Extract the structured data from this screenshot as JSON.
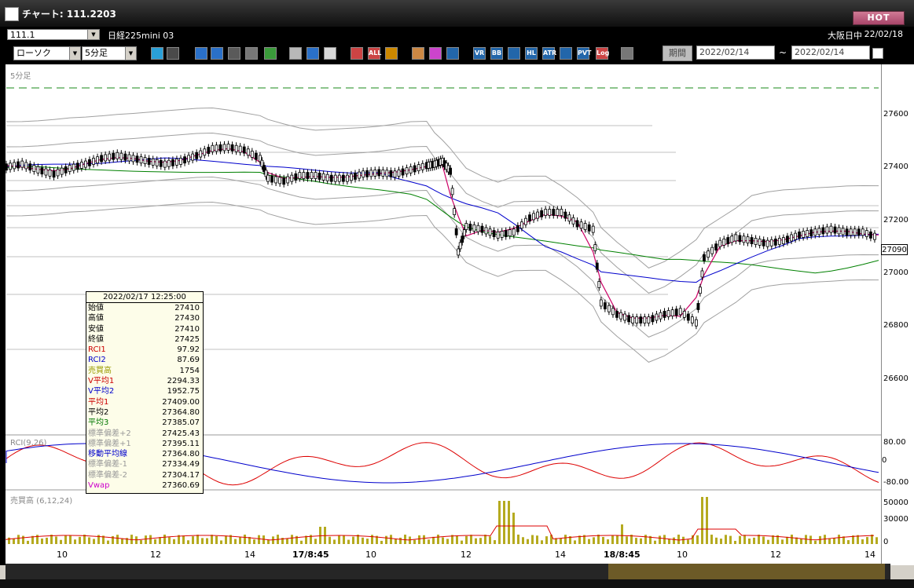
{
  "window": {
    "title": "チャート: 111.2203",
    "hot_label": "HOT"
  },
  "symbol_bar": {
    "code": "111.1",
    "name": "日経225mini 03",
    "market": "大阪日中",
    "date": "22/02/18"
  },
  "toolbar": {
    "chart_type": "ローソク",
    "interval": "5分足",
    "icons": [
      "zoom-icon",
      "cursor-icon",
      "down-icon",
      "search-icon",
      "grid-icon",
      "frame-icon",
      "pen-icon",
      "pointer-icon",
      "return-icon",
      "candle-icon",
      "bar-icon",
      "all-icon",
      "gear-icon",
      "wrench-icon",
      "color-icon",
      "ma-icon",
      "vr-icon",
      "bb-icon",
      "vwap-icon",
      "hl-icon",
      "atr-icon",
      "para-icon",
      "pvt-icon",
      "log-icon",
      "export-icon"
    ],
    "icon_labels": {
      "all": "ALL",
      "vr": "VR",
      "bb": "BB",
      "hl": "HL",
      "atr": "ATR",
      "pvt": "PVT",
      "log": "Log"
    },
    "period_label": "期間",
    "date_from": "2022/02/14",
    "date_to": "2022/02/14",
    "tilde": "~"
  },
  "chart": {
    "interval_label": "5分足",
    "price_ticks": [
      "27600",
      "27400",
      "27200",
      "27000",
      "26800",
      "26600"
    ],
    "last_price": "27090",
    "rci_label": "RCI(9,26)",
    "rci_ticks": [
      "80.00",
      "0",
      "-80.00"
    ],
    "volume_label": "売買高 (6,12,24)",
    "volume_ticks": [
      "50000",
      "30000",
      "0"
    ],
    "x_ticks": [
      "10",
      "12",
      "14",
      "17/8:45",
      "10",
      "12",
      "14",
      "18/8:45",
      "10",
      "12",
      "14"
    ]
  },
  "chart_data": {
    "type": "candlestick",
    "title": "5分足",
    "ylim": [
      26440,
      27720
    ],
    "y_ticks": [
      27600,
      27400,
      27200,
      27000,
      26800,
      26600
    ],
    "session_breaks": [
      "17/8:45",
      "18/8:45"
    ],
    "close_path": [
      [
        0,
        27380
      ],
      [
        8,
        27390
      ],
      [
        16,
        27370
      ],
      [
        24,
        27355
      ],
      [
        32,
        27375
      ],
      [
        40,
        27390
      ],
      [
        48,
        27410
      ],
      [
        56,
        27420
      ],
      [
        64,
        27410
      ],
      [
        72,
        27400
      ],
      [
        80,
        27390
      ],
      [
        88,
        27400
      ],
      [
        96,
        27420
      ],
      [
        104,
        27445
      ],
      [
        112,
        27450
      ],
      [
        120,
        27440
      ],
      [
        128,
        27410
      ],
      [
        132,
        27340
      ],
      [
        140,
        27330
      ],
      [
        148,
        27350
      ],
      [
        156,
        27350
      ],
      [
        164,
        27340
      ],
      [
        172,
        27340
      ],
      [
        180,
        27355
      ],
      [
        188,
        27360
      ],
      [
        196,
        27355
      ],
      [
        204,
        27370
      ],
      [
        212,
        27385
      ],
      [
        216,
        27390
      ],
      [
        220,
        27400
      ],
      [
        224,
        27365
      ],
      [
        228,
        27080
      ],
      [
        232,
        27170
      ],
      [
        240,
        27160
      ],
      [
        248,
        27140
      ],
      [
        256,
        27150
      ],
      [
        264,
        27200
      ],
      [
        272,
        27220
      ],
      [
        280,
        27220
      ],
      [
        288,
        27180
      ],
      [
        296,
        27160
      ],
      [
        300,
        26900
      ],
      [
        308,
        26860
      ],
      [
        316,
        26840
      ],
      [
        324,
        26840
      ],
      [
        332,
        26860
      ],
      [
        340,
        26870
      ],
      [
        348,
        26830
      ],
      [
        352,
        27060
      ],
      [
        360,
        27110
      ],
      [
        368,
        27130
      ],
      [
        376,
        27120
      ],
      [
        384,
        27110
      ],
      [
        392,
        27120
      ],
      [
        400,
        27140
      ],
      [
        408,
        27150
      ],
      [
        416,
        27160
      ],
      [
        424,
        27150
      ],
      [
        432,
        27150
      ],
      [
        440,
        27130
      ]
    ],
    "info_panel": {
      "datetime": "2022/02/17  12:25:00",
      "open": 27410,
      "high": 27430,
      "low": 27410,
      "close": 27425,
      "RCI1": 97.92,
      "RCI2": 87.69,
      "volume": 1754,
      "V_avg1": 2294.33,
      "V_avg2": 1952.75,
      "avg1": 27409.0,
      "avg2": 27364.8,
      "avg3": 27385.07,
      "std_plus2": 27425.43,
      "std_plus1": 27395.11,
      "ma": 27364.8,
      "std_minus1": 27334.49,
      "std_minus2": 27304.17,
      "vwap": 27360.69
    }
  },
  "info": {
    "datetime": "2022/02/17  12:25:00",
    "rows": [
      {
        "k": "始値",
        "v": "27410",
        "c": "#000"
      },
      {
        "k": "高値",
        "v": "27430",
        "c": "#000"
      },
      {
        "k": "安値",
        "v": "27410",
        "c": "#000"
      },
      {
        "k": "終値",
        "v": "27425",
        "c": "#000"
      },
      {
        "k": "RCI1",
        "v": "97.92",
        "c": "#cc0000"
      },
      {
        "k": "RCI2",
        "v": "87.69",
        "c": "#0000cc"
      },
      {
        "k": "売買高",
        "v": "1754",
        "c": "#9a9a00"
      },
      {
        "k": "V平均1",
        "v": "2294.33",
        "c": "#cc0000"
      },
      {
        "k": "V平均2",
        "v": "1952.75",
        "c": "#0000cc"
      },
      {
        "k": "平均1",
        "v": "27409.00",
        "c": "#cc0000"
      },
      {
        "k": "平均2",
        "v": "27364.80",
        "c": "#000"
      },
      {
        "k": "平均3",
        "v": "27385.07",
        "c": "#007700"
      },
      {
        "k": "標準偏差+2",
        "v": "27425.43",
        "c": "#999"
      },
      {
        "k": "標準偏差+1",
        "v": "27395.11",
        "c": "#999"
      },
      {
        "k": "移動平均線",
        "v": "27364.80",
        "c": "#0000cc"
      },
      {
        "k": "標準偏差-1",
        "v": "27334.49",
        "c": "#999"
      },
      {
        "k": "標準偏差-2",
        "v": "27304.17",
        "c": "#999"
      },
      {
        "k": "Vwap",
        "v": "27360.69",
        "c": "#cc00cc"
      }
    ]
  },
  "colors": {
    "avg1": "#cc0000",
    "avg2": "#0000cc",
    "avg3": "#008000",
    "vwap": "#cc0066",
    "band": "#a0a0a0",
    "volume": "#b5aa1f",
    "hot": "#a8456a"
  }
}
